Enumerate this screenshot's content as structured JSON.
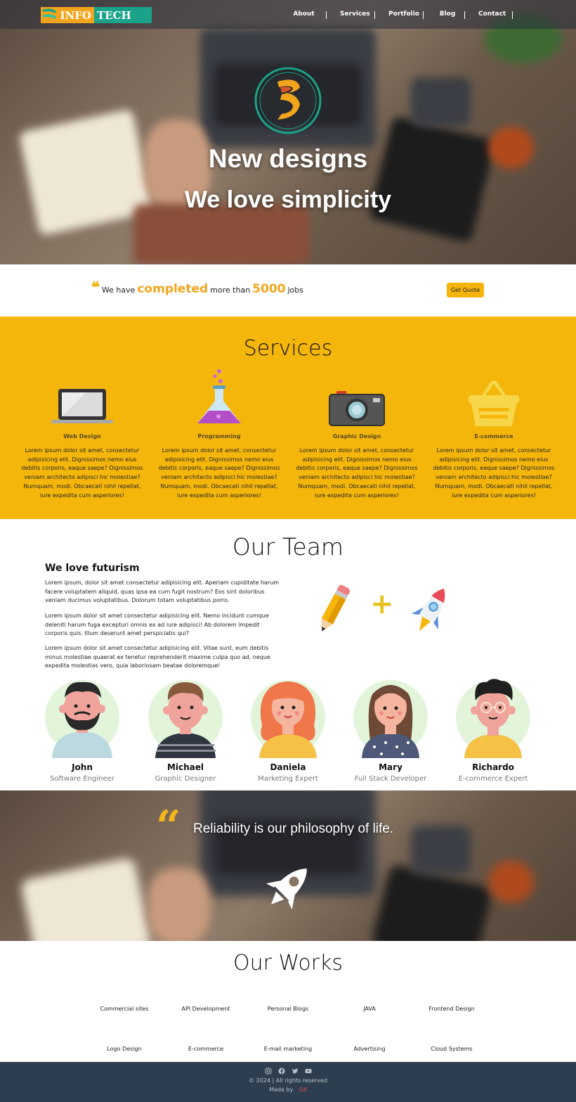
{
  "navbar": {
    "logo": {
      "part1": "INFO",
      "part2": "TECH"
    },
    "links": [
      "About",
      "Services",
      "Portfolio",
      "Blog",
      "Contact"
    ]
  },
  "hero": {
    "title": "New designs",
    "subtitle": "We love simplicity"
  },
  "stats": {
    "prefix": "We have",
    "highlight": "completed",
    "middle": "more than",
    "number": "5000",
    "suffix": "jobs",
    "button": "Get Quote"
  },
  "services": {
    "title": "Services",
    "items": [
      {
        "name": "Web Design",
        "icon": "laptop-icon",
        "desc": "Lorem ipsum dolor sit amet, consectetur adipisicing elit. Dignissimos nemo eius debitis corporis, eaque saepe? Dignissimos veniam architecto adipisci hic molestiae? Numquam, modi. Obcaecati nihil repellat, iure expedita cum asperiores!"
      },
      {
        "name": "Programming",
        "icon": "flask-icon",
        "desc": "Lorem ipsum dolor sit amet, consectetur adipisicing elit. Dignissimos nemo eius debitis corporis, eaque saepe? Dignissimos veniam architecto adipisci hic molestiae? Numquam, modi. Obcaecati nihil repellat, iure expedita cum asperiores!"
      },
      {
        "name": "Graphic Design",
        "icon": "camera-icon",
        "desc": "Lorem ipsum dolor sit amet, consectetur adipisicing elit. Dignissimos nemo eius debitis corporis, eaque saepe? Dignissimos veniam architecto adipisci hic molestiae? Numquam, modi. Obcaecati nihil repellat, iure expedita cum asperiores!"
      },
      {
        "name": "E-commerce",
        "icon": "basket-icon",
        "desc": "Lorem ipsum dolor sit amet, consectetur adipisicing elit. Dignissimos nemo eius debitis corporis, eaque saepe? Dignissimos veniam architecto adipisci hic molestiae? Numquam, modi. Obcaecati nihil repellat, iure expedita cum asperiores!"
      }
    ]
  },
  "team": {
    "title": "Our Team",
    "subtitle": "We love futurism",
    "paragraphs": [
      "Lorem ipsum, dolor sit amet consectetur adipisicing elit. Aperiam cupiditate harum facere voluptatem aliquid, quas ipsa ea cum fugit nostrum? Eos sint doloribus veniam ducimus voluptatibus. Dolorum totam voluptatibus porro.",
      "Lorem ipsum dolor sit amet consectetur adipisicing elit. Nemo incidunt cumque deleniti harum fuga excepturi omnis ex ad iure adipisci! Ab dolorem impedit corporis quis. Illum deserunt amet perspiciatis qui?",
      "Lorem ipsum dolor sit amet consectetur adipisicing elit. Vitae sunt, eum debitis minus molestiae quaerat ex tenetur reprehenderit maxime culpa quo ad, neque expedita molestias vero, quia laboriosam beatae doloremque!"
    ],
    "plus": "+",
    "members": [
      {
        "name": "John",
        "role": "Software Engineer"
      },
      {
        "name": "Michael",
        "role": "Graphic Designer"
      },
      {
        "name": "Daniela",
        "role": "Marketing Expert"
      },
      {
        "name": "Mary",
        "role": "Full Stack Developer"
      },
      {
        "name": "Richardo",
        "role": "E-commerce Expert"
      }
    ]
  },
  "band": {
    "quote_mark": "“",
    "text": "Reliability is our philosophy of life."
  },
  "works": {
    "title": "Our Works",
    "items": [
      "Commercial sites",
      "API Development",
      "Personal Blogs",
      "JAVA",
      "Frontend Design",
      "Logo Design",
      "E-commerce",
      "E-mail marketing",
      "Advertising",
      "Cloud Systems"
    ]
  },
  "footer": {
    "copyright": "© 2024 | All rights reserved",
    "made_by_label": "Made by",
    "made_by_name": "OA",
    "social_icons": [
      "instagram-icon",
      "facebook-icon",
      "twitter-icon",
      "youtube-icon"
    ]
  },
  "colors": {
    "accent": "#f5b60c",
    "teal": "#1aa38a",
    "footer_bg": "#2d3e50"
  }
}
